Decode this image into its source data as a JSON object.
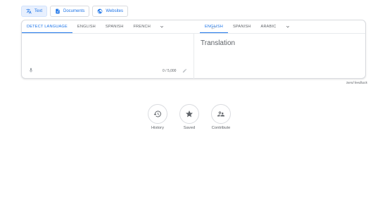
{
  "mode_tabs": [
    {
      "label": "Text",
      "icon": "translate-icon",
      "active": true
    },
    {
      "label": "Documents",
      "icon": "document-icon",
      "active": false
    },
    {
      "label": "Websites",
      "icon": "globe-icon",
      "active": false
    }
  ],
  "source_languages": [
    "DETECT LANGUAGE",
    "ENGLISH",
    "SPANISH",
    "FRENCH"
  ],
  "target_languages": [
    "ENGLISH",
    "SPANISH",
    "ARABIC"
  ],
  "source": {
    "value": "",
    "char_count": "0 / 5,000"
  },
  "target": {
    "placeholder": "Translation"
  },
  "feedback_link": "Send feedback",
  "actions": [
    {
      "label": "History",
      "icon": "history-icon"
    },
    {
      "label": "Saved",
      "icon": "star-icon"
    },
    {
      "label": "Contribute",
      "icon": "people-icon"
    }
  ],
  "colors": {
    "accent": "#1a73e8",
    "muted": "#5f6368",
    "border": "#dadce0"
  }
}
